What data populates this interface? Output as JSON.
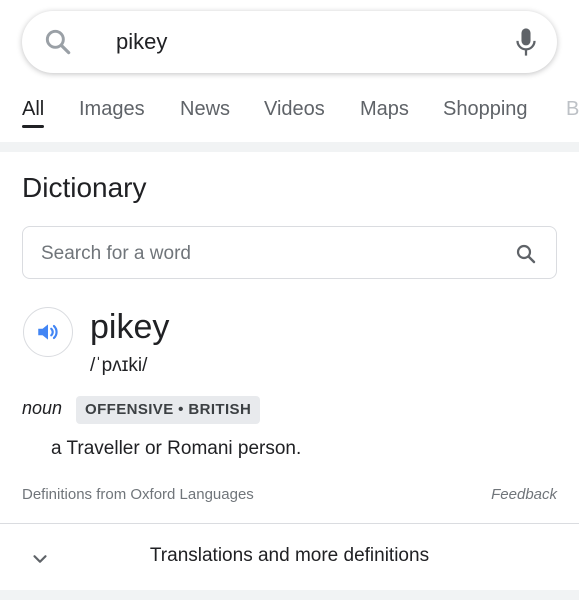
{
  "search": {
    "query": "pikey"
  },
  "tabs": [
    {
      "label": "All",
      "active": true
    },
    {
      "label": "Images",
      "active": false
    },
    {
      "label": "News",
      "active": false
    },
    {
      "label": "Videos",
      "active": false
    },
    {
      "label": "Maps",
      "active": false
    },
    {
      "label": "Shopping",
      "active": false
    },
    {
      "label": "B",
      "active": false
    }
  ],
  "dictionary": {
    "title": "Dictionary",
    "word_search_placeholder": "Search for a word",
    "headword": "pikey",
    "phonetic": "/ˈpʌɪki/",
    "part_of_speech": "noun",
    "label": "OFFENSIVE • BRITISH",
    "definition": "a Traveller or Romani person.",
    "source": "Definitions from Oxford Languages",
    "feedback": "Feedback",
    "more_label": "Translations and more definitions"
  },
  "colors": {
    "accent_blue": "#4285f4",
    "text": "#202124",
    "muted": "#70757a"
  },
  "icons": {
    "search": "search-icon",
    "mic": "mic-icon",
    "speaker": "speaker-icon",
    "chevron": "chevron-down-icon"
  }
}
